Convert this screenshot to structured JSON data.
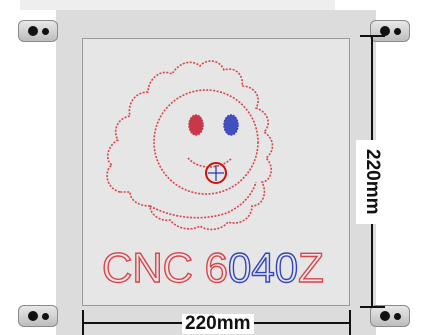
{
  "diagram": {
    "engraving_text": {
      "part1": "CNC 6",
      "part2": "040",
      "part3": "Z"
    },
    "dimension_width": "220mm",
    "dimension_height": "220mm"
  },
  "colors": {
    "thread_red": "#d9434a",
    "thread_blue": "#3344bb",
    "plate": "#dcdcdc",
    "work_area": "#e6e6e6",
    "clamp_hole": "#111111"
  },
  "icons": [
    "clamp-icon",
    "crosshair-icon",
    "smiley-gear-icon"
  ]
}
